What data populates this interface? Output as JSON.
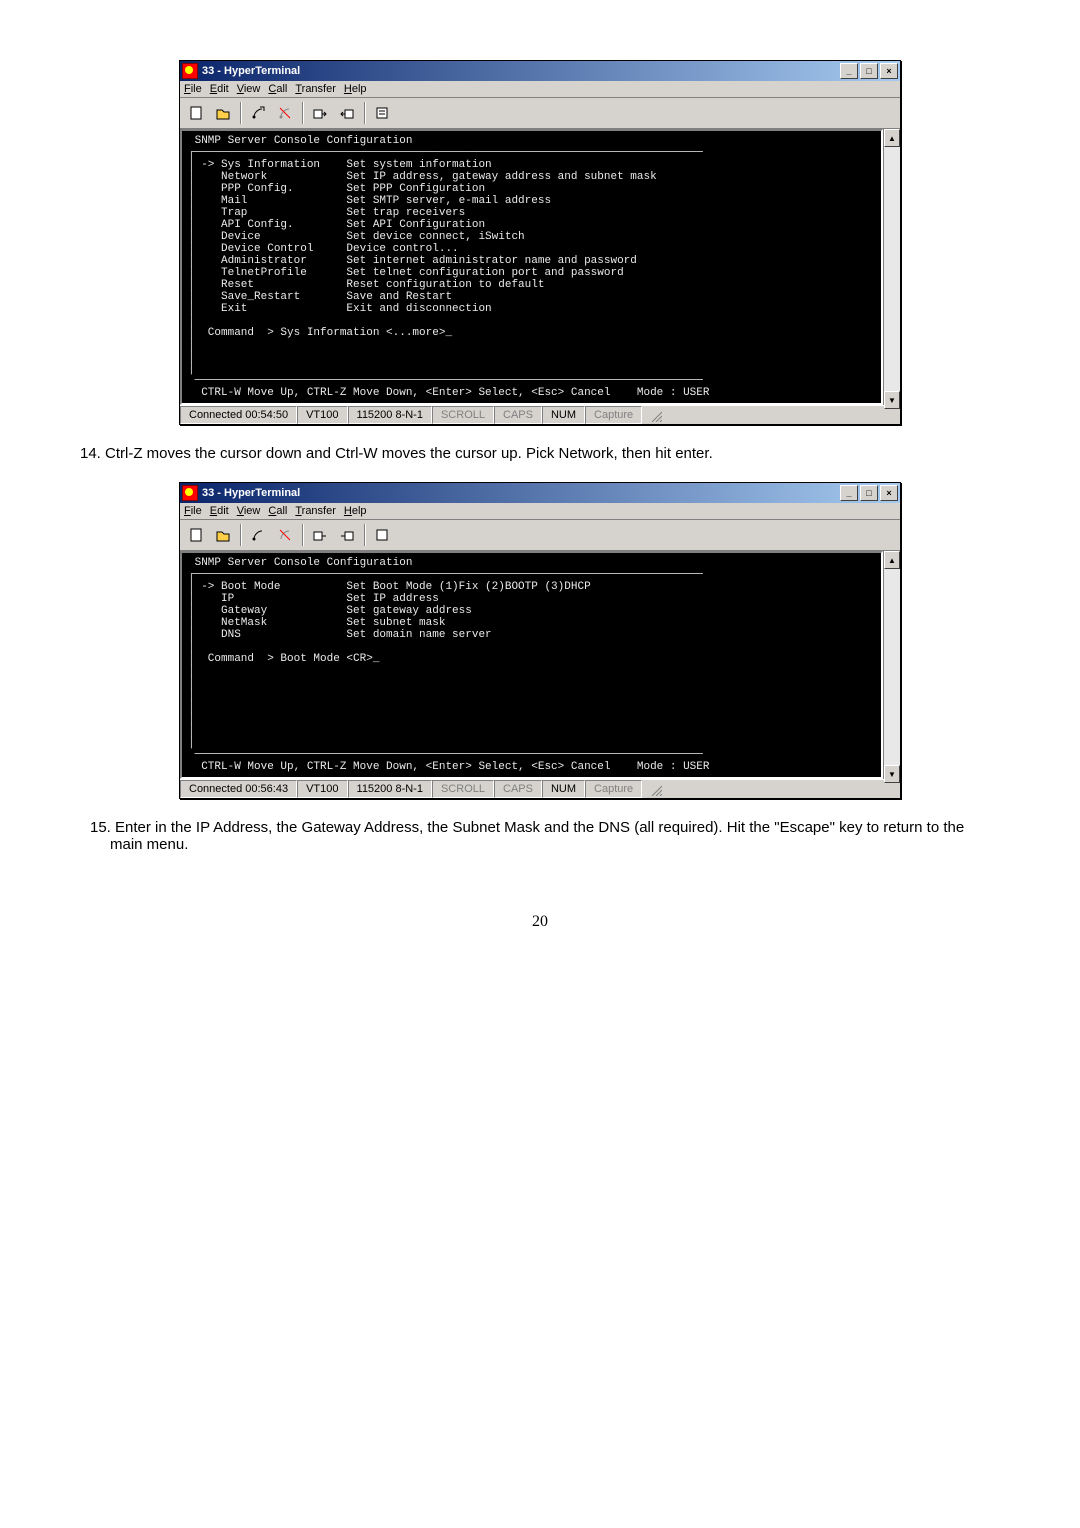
{
  "window": {
    "title": "33 - HyperTerminal",
    "minimize": "_",
    "maximize": "□",
    "close": "×"
  },
  "menu": {
    "file": "File",
    "edit": "Edit",
    "view": "View",
    "call": "Call",
    "transfer": "Transfer",
    "help": "Help"
  },
  "terminal1": {
    "header": " SNMP Server Console Configuration",
    "rule": "┌─────────────────────────────────────────────────────────────────────────────",
    "lines": [
      "│ -> Sys Information    Set system information",
      "│    Network            Set IP address, gateway address and subnet mask",
      "│    PPP Config.        Set PPP Configuration",
      "│    Mail               Set SMTP server, e-mail address",
      "│    Trap               Set trap receivers",
      "│    API Config.        Set API Configuration",
      "│    Device             Set device connect, iSwitch",
      "│    Device Control     Device control...",
      "│    Administrator      Set internet administrator name and password",
      "│    TelnetProfile      Set telnet configuration port and password",
      "│    Reset              Reset configuration to default",
      "│    Save_Restart       Save and Restart",
      "│    Exit               Exit and disconnection",
      "│",
      "│  Command  > Sys Information <...more>_",
      "│",
      "│",
      "│",
      " ─────────────────────────────────────────────────────────────────────────────",
      "  CTRL-W Move Up, CTRL-Z Move Down, <Enter> Select, <Esc> Cancel    Mode : USER"
    ]
  },
  "status1": {
    "time": "Connected 00:54:50",
    "emu": "VT100",
    "baud": "115200 8-N-1",
    "scroll": "SCROLL",
    "caps": "CAPS",
    "num": "NUM",
    "cap": "Capture"
  },
  "text14": "14.  Ctrl-Z moves the cursor down and Ctrl-W moves the cursor up.  Pick Network, then hit enter.",
  "terminal2": {
    "header": " SNMP Server Console Configuration",
    "rule": "┌─────────────────────────────────────────────────────────────────────────────",
    "lines": [
      "│ -> Boot Mode          Set Boot Mode (1)Fix (2)BOOTP (3)DHCP",
      "│    IP                 Set IP address",
      "│    Gateway            Set gateway address",
      "│    NetMask            Set subnet mask",
      "│    DNS                Set domain name server",
      "│",
      "│  Command  > Boot Mode <CR>_",
      "│",
      "│",
      "│",
      "│",
      "│",
      "│",
      "│",
      " ─────────────────────────────────────────────────────────────────────────────",
      "  CTRL-W Move Up, CTRL-Z Move Down, <Enter> Select, <Esc> Cancel    Mode : USER"
    ]
  },
  "status2": {
    "time": "Connected 00:56:43",
    "emu": "VT100",
    "baud": "115200 8-N-1",
    "scroll": "SCROLL",
    "caps": "CAPS",
    "num": "NUM",
    "cap": "Capture"
  },
  "text15": "15.  Enter in the IP Address, the Gateway Address, the Subnet Mask and the DNS (all required).  Hit the \"Escape\" key to return to the main menu.",
  "page": "20"
}
